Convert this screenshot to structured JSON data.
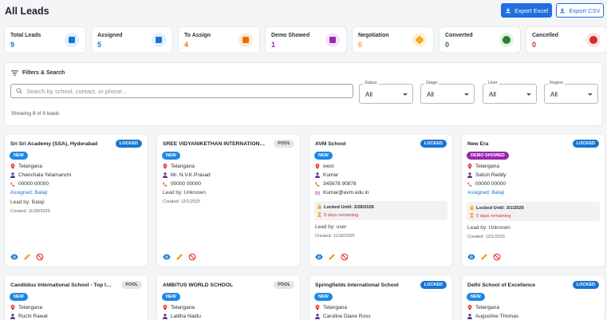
{
  "page": {
    "title": "All Leads"
  },
  "toolbar": {
    "export_excel": "Export Excel",
    "export_csv": "Export CSV"
  },
  "stats": [
    {
      "label": "Total Leads",
      "value": "9",
      "color": "#1976d2",
      "bg": "#e3eefc",
      "icon": "clipboard-icon"
    },
    {
      "label": "Assigned",
      "value": "5",
      "color": "#1976d2",
      "bg": "#e3eefc",
      "icon": "user-badge-icon"
    },
    {
      "label": "To Assign",
      "value": "4",
      "color": "#ef6c00",
      "bg": "#fdebd9",
      "icon": "assignment-icon"
    },
    {
      "label": "Demo Showed",
      "value": "1",
      "color": "#9c27b0",
      "bg": "#f5e3f7",
      "icon": "presentation-icon"
    },
    {
      "label": "Negotiation",
      "value": "0",
      "color": "#f5a623",
      "bg": "#fdf1d9",
      "icon": "handshake-icon"
    },
    {
      "label": "Converted",
      "value": "0",
      "color": "#2e7d32",
      "bg": "#e2f2e3",
      "icon": "check-circle-icon"
    },
    {
      "label": "Cancelled",
      "value": "0",
      "color": "#d32f2f",
      "bg": "#fbe3e3",
      "icon": "cancel-icon"
    }
  ],
  "filters": {
    "title": "Filters & Search",
    "search_placeholder": "Search by school, contact, or phone...",
    "selects": [
      {
        "label": "Status",
        "value": "All"
      },
      {
        "label": "Stage",
        "value": "All"
      },
      {
        "label": "User",
        "value": "All"
      },
      {
        "label": "Region",
        "value": "All"
      }
    ],
    "showing": "Showing 9 of 9 leads"
  },
  "leads": [
    {
      "name": "Sri Sri Academy (SSA), Hyderabad",
      "status": "LOCKED",
      "stage": "NEW",
      "stage_color": "#1e88e5",
      "region": "Telangana",
      "contact": "Chanchala Yelamanchi",
      "phone": "00000 00000",
      "assigned": "Assigned: Balaji",
      "lead_by": "Lead by: Balaji",
      "created": "Created: 11/28/2025"
    },
    {
      "name": "SREE VIDYANIKETHAN INTERNATIONAL SC...",
      "status": "POOL",
      "stage": "NEW",
      "stage_color": "#1e88e5",
      "region": "Telangana",
      "contact": "Mr. N.V.K.Prasad",
      "phone": "00000 00000",
      "lead_by": "Lead by: Unknown",
      "created": "Created: 12/1/2025"
    },
    {
      "name": "AVM School",
      "status": "LOCKED",
      "stage": "NEW",
      "stage_color": "#1e88e5",
      "region": "west",
      "contact": "Kumar",
      "phone": "345678 90878",
      "email": "Kumar@avm.edu.in",
      "locked_until": "Locked Until: 2/28/2026",
      "remaining": "0 days remaining",
      "lead_by": "Lead by: user",
      "created": "Created: 11/26/2025"
    },
    {
      "name": "New Era",
      "status": "LOCKED",
      "stage": "DEMO SHOWED",
      "stage_color": "#9c27b0",
      "region": "Telangana",
      "contact": "Satish Reddy",
      "phone": "00000 00000",
      "assigned": "Assigned: Balaji",
      "locked_until": "Locked Until: 3/1/2026",
      "remaining": "0 days remaining",
      "lead_by": "Lead by: Unknown",
      "created": "Created: 12/1/2025"
    },
    {
      "name": "Candiidus International School - Top Intern...",
      "status": "POOL",
      "stage": "NEW",
      "stage_color": "#1e88e5",
      "region": "Telangana",
      "contact": "Ruchi Rawat"
    },
    {
      "name": "AMBITUS WORLD SCHOOL",
      "status": "POOL",
      "stage": "NEW",
      "stage_color": "#1e88e5",
      "region": "Telangana",
      "contact": "Lalitha Naidu"
    },
    {
      "name": "Springfields International School",
      "status": "LOCKED",
      "stage": "NEW",
      "stage_color": "#1e88e5",
      "region": "Telangana",
      "contact": "Caroline Diane Ross"
    },
    {
      "name": "Delhi School of Excellence",
      "status": "LOCKED",
      "stage": "NEW",
      "stage_color": "#1e88e5",
      "region": "Telangana",
      "contact": "Augustine Thomas"
    }
  ]
}
